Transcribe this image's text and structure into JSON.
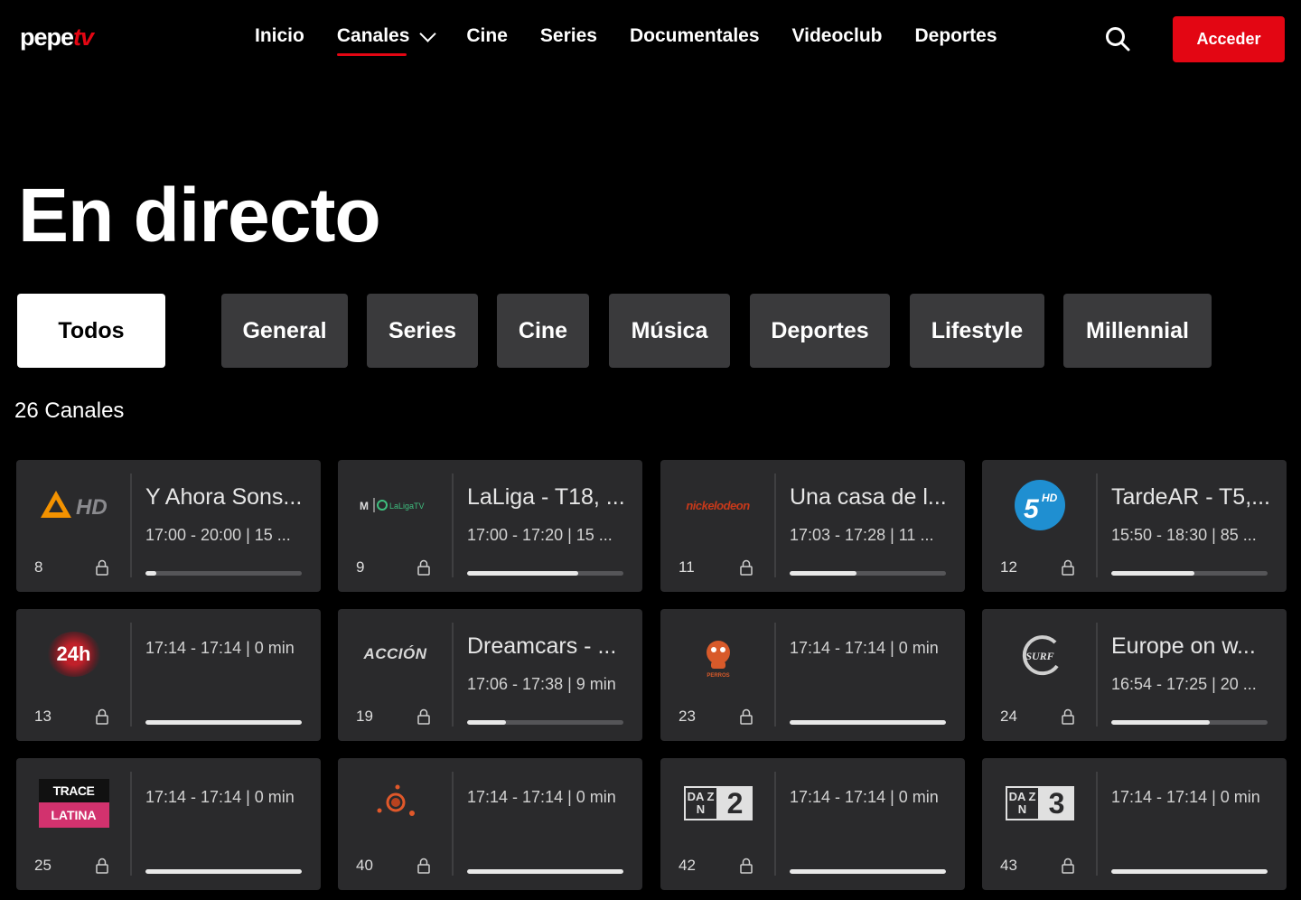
{
  "brand": {
    "logo_main": "pepe",
    "logo_accent": "tv",
    "accent_color": "#e30613"
  },
  "nav": {
    "items": [
      {
        "label": "Inicio",
        "active": false
      },
      {
        "label": "Canales",
        "active": true,
        "dropdown": true
      },
      {
        "label": "Cine",
        "active": false
      },
      {
        "label": "Series",
        "active": false
      },
      {
        "label": "Documentales",
        "active": false
      },
      {
        "label": "Videoclub",
        "active": false
      },
      {
        "label": "Deportes",
        "active": false
      }
    ],
    "search_icon": "search-icon",
    "login_label": "Acceder"
  },
  "page": {
    "title": "En directo",
    "channel_count": "26 Canales"
  },
  "filters": [
    {
      "label": "Todos",
      "selected": true
    },
    {
      "label": "General",
      "selected": false
    },
    {
      "label": "Series",
      "selected": false
    },
    {
      "label": "Cine",
      "selected": false
    },
    {
      "label": "Música",
      "selected": false
    },
    {
      "label": "Deportes",
      "selected": false
    },
    {
      "label": "Lifestyle",
      "selected": false
    },
    {
      "label": "Millennial",
      "selected": false
    }
  ],
  "channels": [
    {
      "number": "8",
      "logo": "antena3-hd-logo",
      "logo_text": "HD",
      "title": "Y Ahora Sons...",
      "time": "17:00 - 20:00  |  15 ...",
      "progress": 0.07
    },
    {
      "number": "9",
      "logo": "laliga-tv-logo",
      "logo_text": "LaLigaTV",
      "title": "LaLiga - T18, ...",
      "time": "17:00 - 17:20  |  15 ...",
      "progress": 0.71
    },
    {
      "number": "11",
      "logo": "nickelodeon-logo",
      "logo_text": "nickelodeon",
      "title": "Una casa de l...",
      "time": "17:03 - 17:28  |  11 ...",
      "progress": 0.43
    },
    {
      "number": "12",
      "logo": "cinco-hd-logo",
      "logo_text": "5",
      "logo_sup": "HD",
      "title": "TardeAR - T5,...",
      "time": "15:50 - 18:30  |  85 ...",
      "progress": 0.53
    },
    {
      "number": "13",
      "logo": "24h-logo",
      "logo_text": "24h",
      "title": "",
      "time": "17:14 - 17:14  |  0 min",
      "progress": 1.0
    },
    {
      "number": "19",
      "logo": "accion-logo",
      "logo_text": "ACCIÓN",
      "title": "Dreamcars - ...",
      "time": "17:06 - 17:38  |  9 min",
      "progress": 0.25
    },
    {
      "number": "23",
      "logo": "vivir-con-perros-logo",
      "logo_text": "PERROS",
      "title": "",
      "time": "17:14 - 17:14  |  0 min",
      "progress": 1.0
    },
    {
      "number": "24",
      "logo": "surf-channel-logo",
      "logo_text": "SURF",
      "title": "Europe on w...",
      "time": "16:54 - 17:25  |  20 ...",
      "progress": 0.63
    },
    {
      "number": "25",
      "logo": "trace-latina-logo",
      "logo_text": "TRACE",
      "logo_text2": "LATINA",
      "title": "",
      "time": "17:14 - 17:14  |  0 min",
      "progress": 1.0
    },
    {
      "number": "40",
      "logo": "orbit-dots-logo",
      "logo_text": "",
      "title": "",
      "time": "17:14 - 17:14  |  0 min",
      "progress": 1.0
    },
    {
      "number": "42",
      "logo": "dazn-2-logo",
      "logo_text": "DA ZN",
      "logo_num": "2",
      "title": "",
      "time": "17:14 - 17:14  |  0 min",
      "progress": 1.0
    },
    {
      "number": "43",
      "logo": "dazn-3-logo",
      "logo_text": "DA ZN",
      "logo_num": "3",
      "title": "",
      "time": "17:14 - 17:14  |  0 min",
      "progress": 1.0
    }
  ]
}
